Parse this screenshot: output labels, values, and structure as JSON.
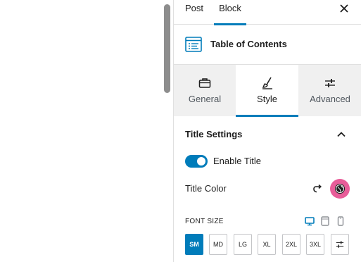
{
  "colors": {
    "accent": "#007cba",
    "swatch": "#e85d99"
  },
  "sidebar_tabs": {
    "post": "Post",
    "block": "Block"
  },
  "close_icon": "close-icon",
  "block": {
    "icon": "table-of-contents-icon",
    "title": "Table of Contents"
  },
  "style_tabs": [
    {
      "label": "General",
      "icon": "briefcase-icon"
    },
    {
      "label": "Style",
      "icon": "brush-icon",
      "active": true
    },
    {
      "label": "Advanced",
      "icon": "sliders-icon"
    }
  ],
  "section": {
    "title": "Title Settings",
    "icon": "chevron-up-icon"
  },
  "enable_title": {
    "label": "Enable Title",
    "on": true
  },
  "title_color": {
    "label": "Title Color",
    "reset_icon": "reset-icon"
  },
  "font_size": {
    "label": "FONT SIZE",
    "devices": [
      "desktop-icon",
      "tablet-icon",
      "mobile-icon"
    ],
    "options": [
      "SM",
      "MD",
      "LG",
      "XL",
      "2XL",
      "3XL"
    ],
    "selected": "SM",
    "custom_icon": "sliders-icon"
  }
}
